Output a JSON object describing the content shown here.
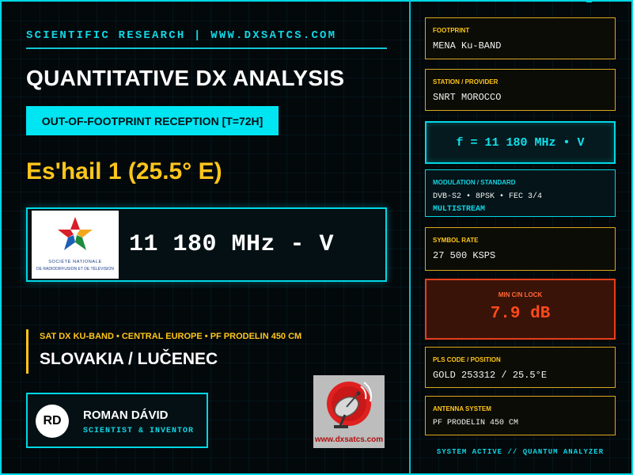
{
  "header": {
    "tagline": "SCIENTIFIC RESEARCH | WWW.DXSATCS.COM",
    "title": "QUANTITATIVE DX ANALYSIS",
    "badge": "OUT-OF-FOOTPRINT RECEPTION [T=72H]"
  },
  "satellite": "Es'hail 1 (25.5° E)",
  "frequency_display": "11 180 MHz - V",
  "broadcaster_logo": {
    "icon": "snrt-star-logo-icon",
    "text_line1": "SOCIÉTÉ NATIONALE",
    "text_line2": "DE RADIODIFFUSION ET DE TÉLÉVISION"
  },
  "location": {
    "subtitle": "SAT DX KU-BAND • CENTRAL EUROPE • PF PRODELIN 450 CM",
    "place": "SLOVAKIA / LUČENEC"
  },
  "author": {
    "initials": "RD",
    "name": "ROMAN DÁVID",
    "role": "SCIENTIST & INVENTOR"
  },
  "site_logo": {
    "icon": "satellite-dish-icon",
    "text": "www.dxsatcs.com"
  },
  "panel": {
    "footprint": {
      "label": "FOOTPRINT",
      "value": "MENA Ku-BAND"
    },
    "station": {
      "label": "STATION / PROVIDER",
      "value": "SNRT MOROCCO"
    },
    "frequency": "f = 11 180 MHz • V",
    "modulation": {
      "label": "MODULATION / STANDARD",
      "value": "DVB-S2 • 8PSK • FEC 3/4",
      "extra": "MULTISTREAM"
    },
    "symbol_rate": {
      "label": "SYMBOL RATE",
      "value": "27 500 KSPS"
    },
    "cn_lock": {
      "label": "MIN C/N LOCK",
      "value": "7.9 dB"
    },
    "pls": {
      "label": "PLS CODE / POSITION",
      "value": "GOLD 253312 / 25.5°E"
    },
    "antenna": {
      "label": "ANTENNA SYSTEM",
      "value": "PF PRODELIN 450 CM"
    },
    "status": "SYSTEM ACTIVE // QUANTUM ANALYZER"
  },
  "colors": {
    "accent_cyan": "#00d8e6",
    "accent_gold": "#ffc61a",
    "alert_red": "#ff4a1a",
    "background": "#03080b"
  }
}
